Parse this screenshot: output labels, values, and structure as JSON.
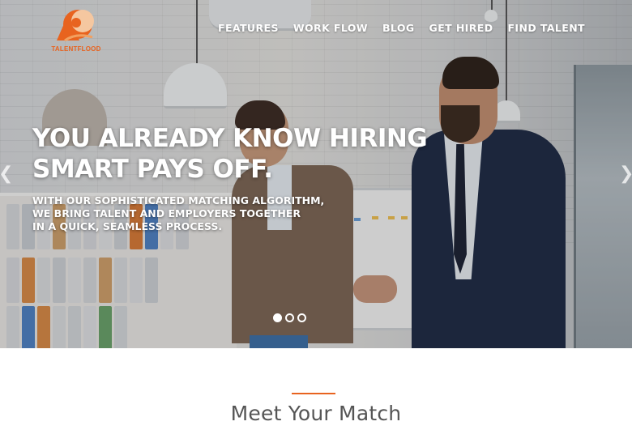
{
  "brand": {
    "logo_text": "TALENTFLOOD",
    "accent_color": "#e8631f"
  },
  "nav": {
    "items": [
      {
        "label": "FEATURES"
      },
      {
        "label": "WORK FLOW"
      },
      {
        "label": "BLOG"
      },
      {
        "label": "GET HIRED"
      },
      {
        "label": "FIND TALENT"
      }
    ]
  },
  "hero": {
    "headline_line1": "YOU ALREADY KNOW HIRING",
    "headline_line2": "SMART PAYS OFF.",
    "sub_line1": "WITH OUR SOPHISTICATED MATCHING ALGORITHM,",
    "sub_line2": "WE BRING TALENT AND EMPLOYERS TOGETHER",
    "sub_line3": "IN A QUICK, SEAMLESS PROCESS.",
    "prev_icon": "chevron-left-icon",
    "next_icon": "chevron-right-icon",
    "slides_total": 3,
    "slide_active": 1
  },
  "section": {
    "title": "Meet Your Match"
  }
}
